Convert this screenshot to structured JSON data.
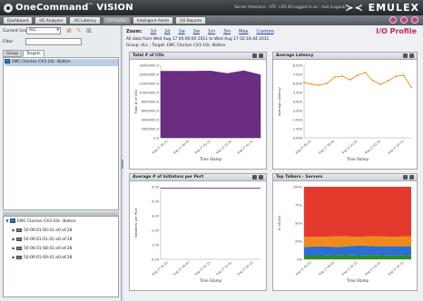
{
  "header": {
    "brand": "OneCommand",
    "brand_mark": "™",
    "brand_suffix": "VISION",
    "status": "Server timezone : UTC +05:30   Logged in as : root   (Logout)",
    "company": "EMULEX"
  },
  "nav": {
    "tabs": [
      {
        "label": "Dashboard",
        "active": false
      },
      {
        "label": "I/O Analyzer",
        "active": false
      },
      {
        "label": "I/O Latency",
        "active": false
      },
      {
        "label": "I/O Profile",
        "active": true
      },
      {
        "label": "Intelligent Alerts",
        "active": false
      },
      {
        "label": "I/O Reports",
        "active": false
      }
    ],
    "icon_color": "#c83a8a"
  },
  "left": {
    "current_group_label": "Current Group:",
    "current_group_value": "ALL",
    "filter_label": "Filter:",
    "filter_value": "",
    "tabs": [
      "Group",
      "Targets"
    ],
    "active_tab": "Targets",
    "top_tree": [
      {
        "label": "EMC Clariion CX3-10c -Bolton",
        "selected": true
      }
    ],
    "bottom_tree": {
      "root": "EMC Clariion CX3-10c -Bolton",
      "ports": [
        "50:06:01:60:41:e0:af:28",
        "50:06:01:61:41:e0:af:28",
        "50:06:01:68:41:e0:af:28",
        "50:06:01:69:41:e0:af:28"
      ]
    }
  },
  "main": {
    "zoom_label": "Zoom:",
    "zoom_options": [
      "1d",
      "2d",
      "1w",
      "2w",
      "1m",
      "3m",
      "Max",
      "Custom"
    ],
    "page_title": "I/O Profile",
    "range_text": "All data from Wed Aug 17 00:00:00  2011   to   Wed Aug 17 02:16:44  2011",
    "group_text": "Group: ALL ;  Target: EMC Clariion CX3-10c -Bolton"
  },
  "chart_data": [
    {
      "type": "area",
      "title": "Total # of I/Os",
      "xlabel": "Time Stamp",
      "ylabel": "Total # of I/Os",
      "ylim": [
        0,
        16000000
      ],
      "yticks": [
        "0.0",
        "2000000.0",
        "4000000.0",
        "6000000.0",
        "8000000.0",
        "10000000.0",
        "12000000.0",
        "14000000.0",
        "16000000.0"
      ],
      "x": [
        "Aug 17 00:15",
        "Aug 17 00:45",
        "Aug 17 01:15",
        "Aug 17 01:45",
        "Aug 17 02:15"
      ],
      "values": [
        14700000,
        14700000,
        14700000,
        14750000,
        14200000,
        14800000,
        13900000
      ],
      "color": "#6b2d82",
      "grid": false
    },
    {
      "type": "line",
      "title": "Average Latency",
      "xlabel": "Time Stamp",
      "ylabel": "Average Latency",
      "ylim": [
        0,
        8000
      ],
      "yticks": [
        "0.000",
        "1.000",
        "2.000",
        "3.000",
        "4.000",
        "5.000",
        "6.000",
        "7.000",
        "8.000"
      ],
      "x": [
        "Aug 17 00:15",
        "Aug 17 00:45",
        "Aug 17 01:15",
        "Aug 17 01:45",
        "Aug 17 02:15"
      ],
      "values": [
        6100,
        5900,
        5800,
        6000,
        6700,
        6800,
        6400,
        6900,
        7200,
        6300,
        5900,
        6300,
        6800,
        6900,
        5600
      ],
      "color": "#f08a1c",
      "grid": false
    },
    {
      "type": "line",
      "title": "Average # of Initiators per Port",
      "xlabel": "Time Stamp",
      "ylabel": "Initiators per Port",
      "ylim": [
        0,
        5
      ],
      "yticks": [
        "0.00",
        "1.00",
        "2.00",
        "3.00",
        "4.00",
        "5.00"
      ],
      "x": [
        "Aug 17 00:15",
        "Aug 17 00:45",
        "Aug 17 01:15",
        "Aug 17 01:45",
        "Aug 17 02:15"
      ],
      "values": [
        4.9,
        4.9,
        4.9,
        4.9,
        4.9,
        4.9,
        4.9
      ],
      "color": "#6b2d82",
      "grid": false
    },
    {
      "type": "area",
      "title": "Top Talkers - Servers",
      "xlabel": "Time Stamp",
      "ylabel": "% of I/Os",
      "ylim": [
        0,
        100
      ],
      "yticks": [
        "0%",
        "25%",
        "50%",
        "75%",
        "100%"
      ],
      "x": [
        "Aug 17 00:15",
        "Aug 17 00:45",
        "Aug 17 01:15",
        "Aug 17 01:45",
        "Aug 17 02:15"
      ],
      "stacked": true,
      "series": [
        {
          "values": [
            5,
            5,
            6,
            5,
            6,
            5,
            6
          ],
          "color": "#2e8b2e"
        },
        {
          "values": [
            12,
            13,
            11,
            14,
            12,
            13,
            12
          ],
          "color": "#2b6fd1"
        },
        {
          "values": [
            14,
            13,
            15,
            12,
            14,
            13,
            14
          ],
          "color": "#f08a1c"
        },
        {
          "values": [
            69,
            69,
            68,
            69,
            68,
            69,
            68
          ],
          "color": "#e43a2e"
        }
      ],
      "grid": false
    }
  ]
}
